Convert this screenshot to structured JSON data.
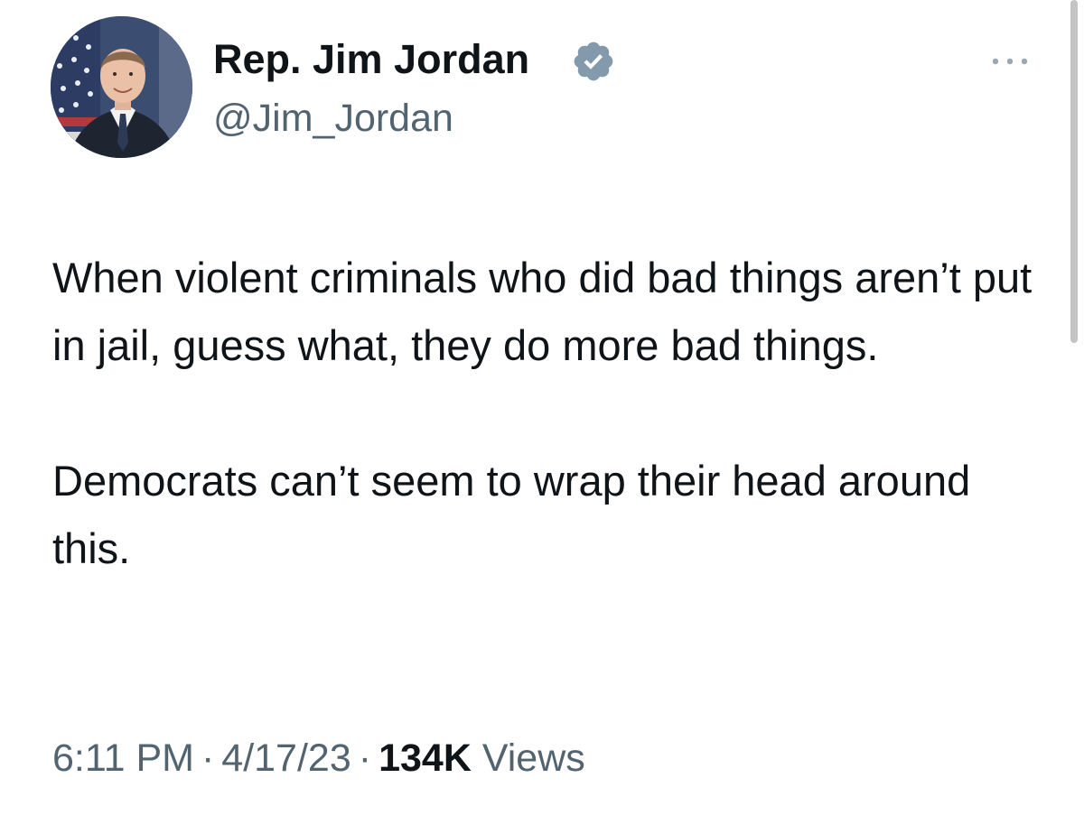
{
  "author": {
    "name": "Rep. Jim Jordan",
    "handle": "@Jim_Jordan",
    "verified_icon": "verified-badge-icon",
    "badge_color": "#829aab"
  },
  "tweet": {
    "paragraphs": [
      "When violent criminals who did bad things aren’t put in jail, guess what, they do more bad things.",
      "Democrats can’t seem to wrap their head around this."
    ]
  },
  "meta": {
    "time": "6:11 PM",
    "separator": "·",
    "date": "4/17/23",
    "views_count": "134K",
    "views_label": "Views"
  },
  "actions": {
    "more_icon": "more-options-icon"
  },
  "colors": {
    "text_primary": "#0f1419",
    "text_secondary": "#536471",
    "background": "#ffffff"
  }
}
